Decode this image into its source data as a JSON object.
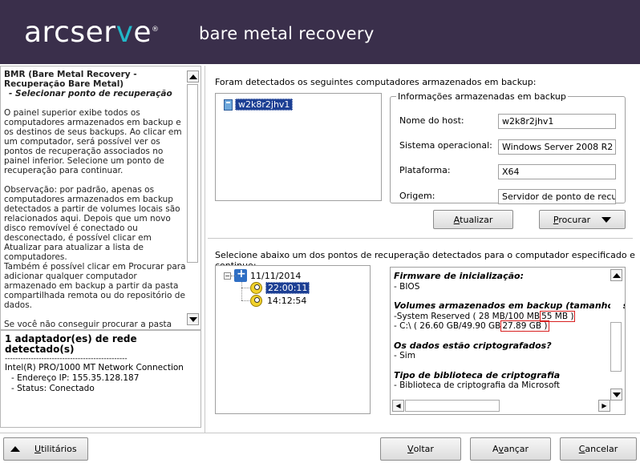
{
  "header": {
    "logo_main": "arcser",
    "logo_v": "v",
    "logo_e": "e",
    "logo_reg": "®",
    "product": "bare metal recovery"
  },
  "left_panel": {
    "title_line1": "BMR (Bare Metal Recovery -",
    "title_line2": "Recuperação Bare Metal)",
    "subtitle": "- Selecionar ponto de recuperação",
    "para1": "O painel superior exibe todos os computadores armazenados em backup e os destinos de seus backups. Ao clicar em um computador, será possível ver os pontos de recuperação associados no painel inferior. Selecione um ponto de recuperação para continuar.",
    "para2": "Observação: por padrão, apenas os computadores armazenados em backup detectados a partir de volumes locais são relacionados aqui. Depois que um novo disco removível é conectado ou desconectado, é possível clicar em Atualizar para atualizar a lista de computadores.",
    "para3": "Também é possível clicar em Procurar para adicionar qualquer computador armazenado em backup a partir da pasta compartilhada remota ou do repositório de dados.",
    "para4": "Se você não conseguir procurar a pasta compartilhada remota, o driver NIC pode não"
  },
  "network": {
    "heading": "1 adaptador(es) de rede detectado(s)",
    "divider": "-----------------------------------------------",
    "adapter": "Intel(R) PRO/1000 MT Network Connection",
    "ip": "- Endereço IP: 155.35.128.187",
    "status": "- Status: Conectado"
  },
  "hosts": {
    "title": "Foram detectados os seguintes computadores armazenados em backup:",
    "items": [
      "w2k8r2jhv1"
    ]
  },
  "info": {
    "legend": "Informações armazenadas em backup",
    "host_label": "Nome do host:",
    "host_value": "w2k8r2jhv1",
    "os_label": "Sistema operacional:",
    "os_value": "Windows Server 2008 R2",
    "platform_label": "Plataforma:",
    "platform_value": "X64",
    "origin_label": "Origem:",
    "origin_value": "Servidor de ponto de recuperação"
  },
  "buttons": {
    "refresh_u": "A",
    "refresh_rest": "tualizar",
    "browse_u": "P",
    "browse_rest": "rocurar",
    "utilities_u": "U",
    "utilities_rest": "tilitários",
    "back_u": "V",
    "back_rest": "oltar",
    "next_pre": "A",
    "next_u": "v",
    "next_rest": "ançar",
    "cancel_u": "C",
    "cancel_rest": "ancelar"
  },
  "recovery": {
    "title": "Selecione abaixo um dos pontos de recuperação detectados para o computador especificado e continue:",
    "date": "11/11/2014",
    "points": [
      "22:00:11",
      "14:12:54"
    ]
  },
  "details": {
    "boot_h": "Firmware de inicialização:",
    "boot_v": "- BIOS",
    "vol_h": "Volumes armazenados em backup (tamanho usa",
    "vol1_pre": "-System Reserved ( 28 MB/100 MB",
    "vol1_box": "55 MB )",
    "vol2_pre": "- C:\\ ( 26.60 GB/49.90 GB",
    "vol2_box": "27.89 GB )",
    "enc_h": "Os dados estão criptografados?",
    "enc_v": "- Sim",
    "lib_h": "Tipo de biblioteca de criptografia",
    "lib_v": "- Biblioteca de criptografia da Microsoft"
  },
  "colors": {
    "header_bg": "#3a2f4b",
    "brand_v": "#21b8c8",
    "selection": "#1c3f94",
    "highlight_box": "#d82020"
  }
}
